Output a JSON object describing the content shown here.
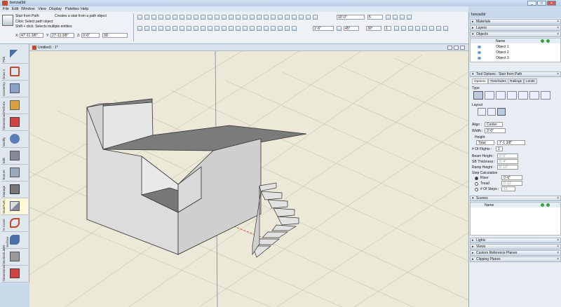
{
  "window": {
    "title": "bonzai3d",
    "min": "_",
    "max": "□",
    "close": "✕"
  },
  "menu": [
    "File",
    "Edit",
    "Window",
    "View",
    "Display",
    "Palettes",
    "Help"
  ],
  "hint": {
    "title": "Stair from Path:",
    "desc": "Creates a stair from a path object",
    "line1": "Click: Select path object",
    "line2": "Shift + click: Selects multiple entities"
  },
  "coords": {
    "x_label": "X:",
    "x": "47'-11 3/8\"",
    "y_label": "Y:",
    "y": "27'-11 3/8\"",
    "z_label": "Z:",
    "z": "0'-0\"",
    "mode": "3D"
  },
  "toolbar_fields": {
    "f1": "10'-0\"",
    "f2": "5",
    "f3": "1'-6\"",
    "f4": "45°",
    "f5": "30°",
    "f6": "1"
  },
  "sidebar_tools": [
    "Pick",
    "Draw 2",
    "Geometry",
    "Perform",
    "Dimensions",
    "Modify",
    "Edit",
    "Texture",
    "Manage",
    "Stair/Path",
    "N-Curve",
    "N-Surface",
    "Section/Line",
    "Dimensions"
  ],
  "doc": {
    "title": "Untitled1 : 1*"
  },
  "panel": {
    "title": "bonzai3d",
    "sections": {
      "materials": "Materials",
      "layers": "Layers",
      "objects": "Objects",
      "scenes": "Scenes",
      "lights": "Lights",
      "views": "Views",
      "crp": "Custom Reference Planes",
      "clip": "Clipping Planes"
    },
    "objects_header": "Name",
    "objects": [
      "Object 1",
      "Object 2",
      "Object 3"
    ],
    "tool_options": {
      "title": "Tool Options : Stair from Path",
      "tabs": [
        "Options",
        "Tres/Sides",
        "Railings",
        "Limits"
      ],
      "type": "Type",
      "layout": "Layout",
      "align": "Align :",
      "align_val": "Center",
      "width": "Width :",
      "width_val": "3'-0\"",
      "height": "Height",
      "total": "Total",
      "total_val": "7'-1 3/8\"",
      "flights": "# Of Flights :",
      "flights_val": "1",
      "beam": "Beam Height :",
      "beam_val": "0'-6\"",
      "sb": "SB Thickness :",
      "sb_val": "0'-4\"",
      "ramp": "Ramp Height :",
      "ramp_val": "0'-10\"",
      "step": "Step Calculation",
      "riser": "Riser",
      "riser_val": "0'-6\"",
      "tread": "Tread",
      "tread_val": "0'-11\"",
      "nsteps": "# Of Steps :",
      "nsteps_val": "15"
    },
    "scenes_header": "Name"
  }
}
